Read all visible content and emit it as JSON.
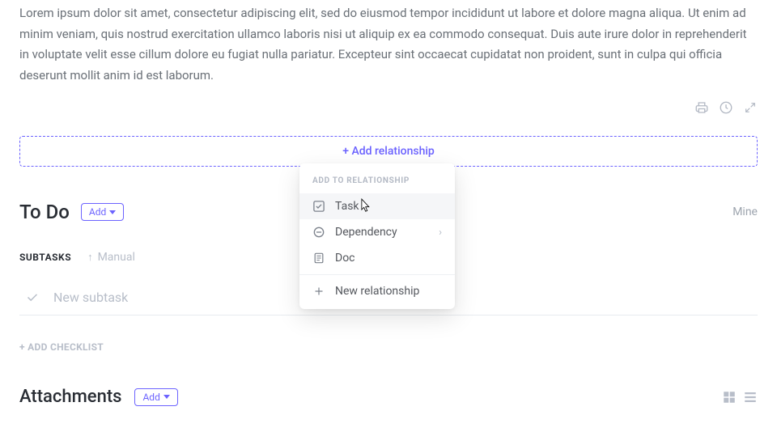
{
  "description": "Lorem ipsum dolor sit amet, consectetur adipiscing elit, sed do eiusmod tempor incididunt ut labore et dolore magna aliqua. Ut enim ad minim veniam, quis nostrud exercitation ullamco laboris nisi ut aliquip ex ea commodo consequat. Duis aute irure dolor in reprehenderit in voluptate velit esse cillum dolore eu fugiat nulla pariatur. Excepteur sint occaecat cupidatat non proident, sunt in culpa qui officia deserunt mollit anim id est laborum.",
  "add_relationship_label": "+ Add relationship",
  "status": {
    "label": "To Do",
    "add_button": "Add"
  },
  "mine_label": "Mine",
  "subtasks": {
    "title": "SUBTASKS",
    "manual_label": "Manual",
    "new_placeholder": "New subtask"
  },
  "add_checklist": "+ ADD CHECKLIST",
  "attachments": {
    "title": "Attachments",
    "add_button": "Add"
  },
  "popup": {
    "header": "ADD TO RELATIONSHIP",
    "items": [
      {
        "label": "Task",
        "icon": "task"
      },
      {
        "label": "Dependency",
        "icon": "dependency",
        "submenu": true
      },
      {
        "label": "Doc",
        "icon": "doc"
      }
    ],
    "new_label": "New relationship"
  }
}
